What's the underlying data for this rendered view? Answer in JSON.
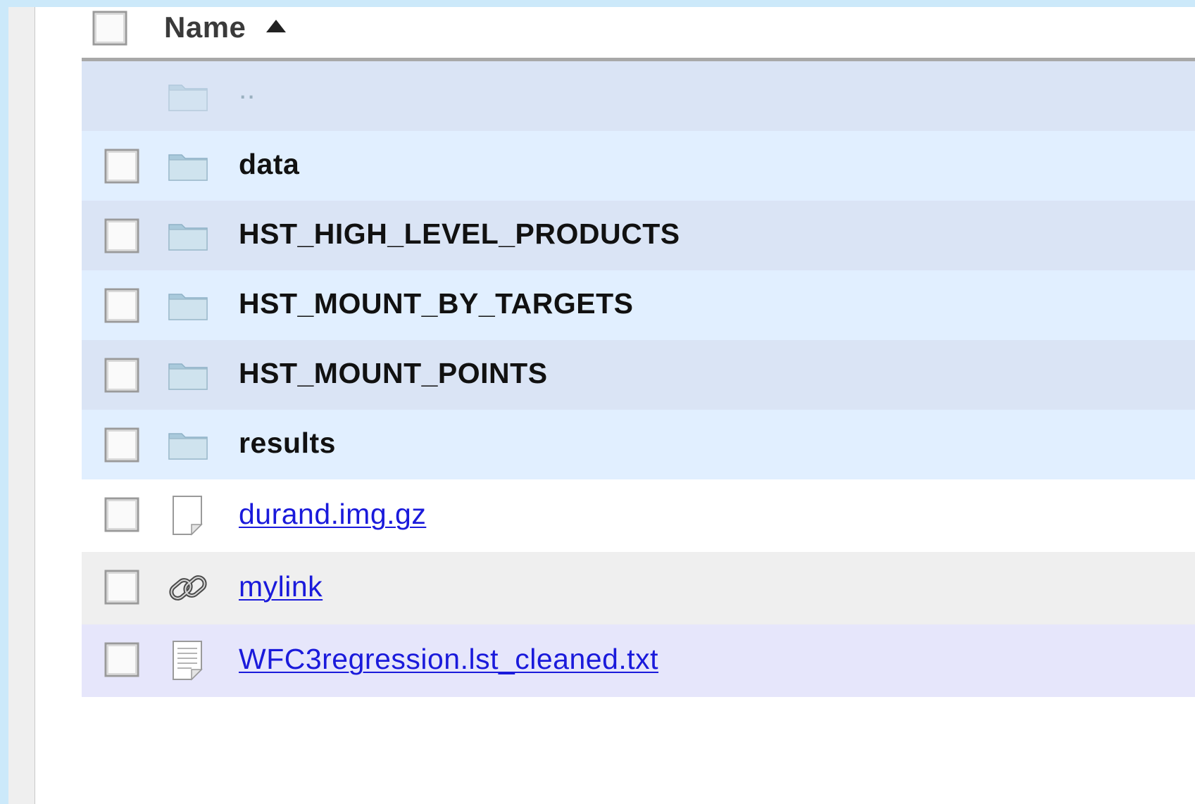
{
  "header": {
    "column_name": "Name",
    "sort_icon": "sort-ascending-icon"
  },
  "rows": [
    {
      "label": "..",
      "type": "parent",
      "icon": "folder-icon",
      "bg": "#dae4f5",
      "has_checkbox": false
    },
    {
      "label": "data",
      "type": "folder",
      "icon": "folder-icon",
      "bg": "#e1efff",
      "has_checkbox": true
    },
    {
      "label": "HST_HIGH_LEVEL_PRODUCTS",
      "type": "folder",
      "icon": "folder-icon",
      "bg": "#dae4f5",
      "has_checkbox": true
    },
    {
      "label": "HST_MOUNT_BY_TARGETS",
      "type": "folder",
      "icon": "folder-icon",
      "bg": "#e1efff",
      "has_checkbox": true
    },
    {
      "label": "HST_MOUNT_POINTS",
      "type": "folder",
      "icon": "folder-icon",
      "bg": "#dae4f5",
      "has_checkbox": true
    },
    {
      "label": "results",
      "type": "folder",
      "icon": "folder-icon",
      "bg": "#e1efff",
      "has_checkbox": true
    },
    {
      "label": "durand.img.gz",
      "type": "file",
      "icon": "file-icon",
      "bg": "#ffffff",
      "has_checkbox": true
    },
    {
      "label": "mylink",
      "type": "link",
      "icon": "chain-link-icon",
      "bg": "#efefef",
      "has_checkbox": true
    },
    {
      "label": "WFC3regression.lst_cleaned.txt",
      "type": "text-file",
      "icon": "text-file-icon",
      "bg": "#e6e6fb",
      "has_checkbox": true
    }
  ],
  "colors": {
    "page_background": "#cce9fa",
    "link": "#1a1adb",
    "folder_fill": "#cfe3ee"
  }
}
